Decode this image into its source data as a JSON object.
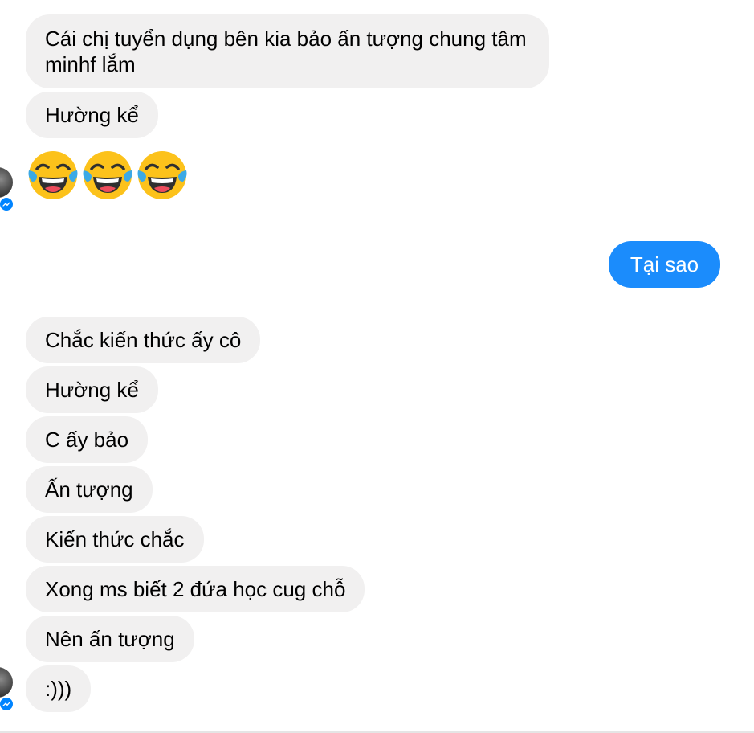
{
  "messages": {
    "m1": "Cái chị tuyển dụng bên kia bảo ấn tượng chung tâm minhf lắm",
    "m2": "Hường kể",
    "m3_emoji": "face-with-tears-of-joy x3",
    "m4_outgoing": "Tại sao",
    "m5": "Chắc kiến thức ấy cô",
    "m6": "Hường kể",
    "m7": "C ấy bảo",
    "m8": "Ấn tượng",
    "m9": "Kiến thức chắc",
    "m10": "Xong ms biết 2 đứa học cug chỗ",
    "m11": "Nên ấn tượng",
    "m12": ":)))"
  },
  "colors": {
    "incoming_bubble": "#f1f0f0",
    "outgoing_bubble": "#1b8cfc",
    "messenger_badge": "#0084ff"
  }
}
